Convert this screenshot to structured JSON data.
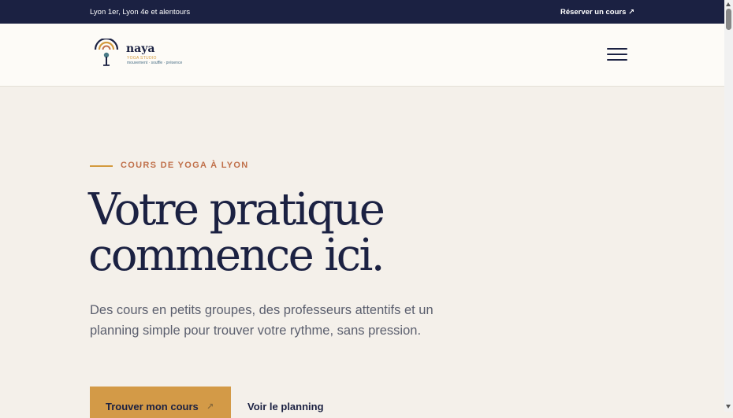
{
  "topbar": {
    "location": "Lyon 1er, Lyon 4e et alentours",
    "book_label": "Réserver un cours ↗"
  },
  "brand": {
    "name": "naya",
    "sub": "YOGA STUDIO",
    "tagline": "mouvement · souffle · présence"
  },
  "hero": {
    "eyebrow": "COURS DE YOGA À LYON",
    "headline_line1": "Votre pratique",
    "headline_line2": "commence ici.",
    "lead": "Des cours en petits groupes, des professeurs attentifs et un planning simple pour trouver votre rythme, sans pression.",
    "primary_cta": "Trouver mon cours",
    "primary_cta_icon": "↗",
    "secondary_cta": "Voir le planning"
  },
  "colors": {
    "navy": "#1b2142",
    "gold": "#d39a47",
    "terracotta": "#c0704a",
    "background": "#f4f0ea"
  },
  "icons": {
    "logo": "yoga-studio-logo-icon",
    "menu": "hamburger-menu-icon",
    "arrow": "arrow-up-right-icon"
  }
}
